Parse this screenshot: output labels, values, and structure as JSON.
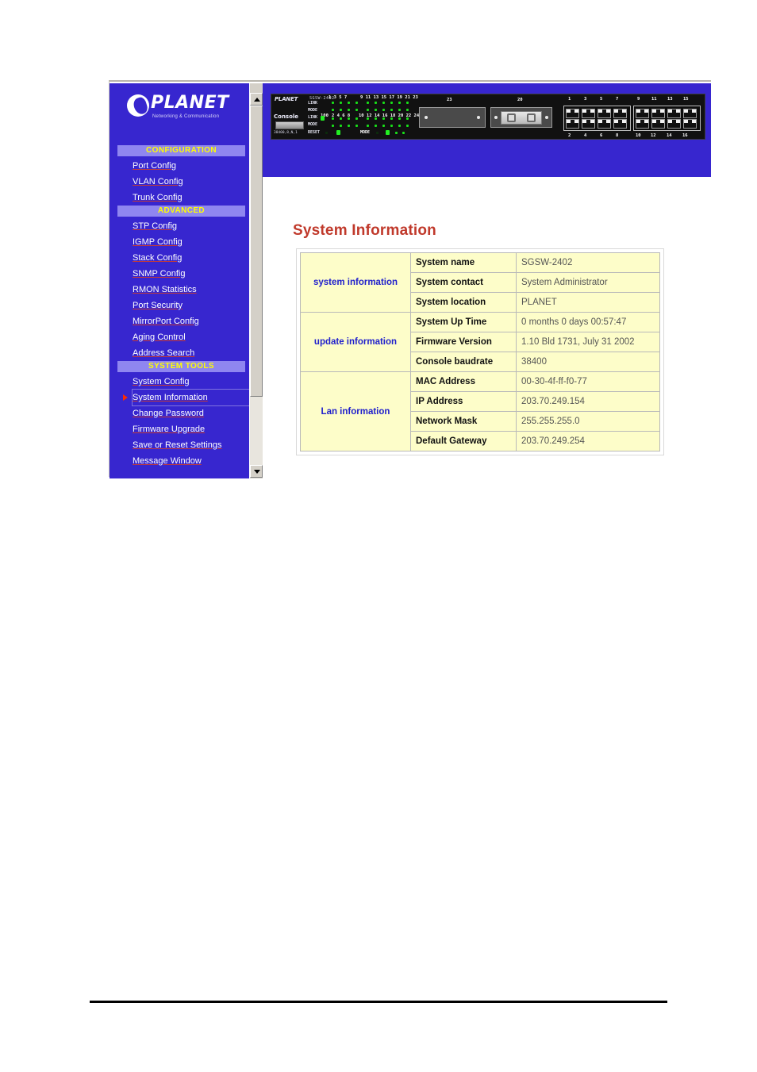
{
  "brand": {
    "name": "PLANET",
    "tagline": "Networking & Communication",
    "logo_icon": "planet-moon-logo-icon"
  },
  "sidebar": {
    "sections": [
      {
        "label": "CONFIGURATION",
        "items": [
          {
            "label": "Port Config",
            "current": false
          },
          {
            "label": "VLAN Config",
            "current": false
          },
          {
            "label": "Trunk Config",
            "current": false
          }
        ]
      },
      {
        "label": "ADVANCED",
        "items": [
          {
            "label": "STP Config",
            "current": false
          },
          {
            "label": "IGMP Config",
            "current": false
          },
          {
            "label": "Stack Config",
            "current": false
          },
          {
            "label": "SNMP Config",
            "current": false
          },
          {
            "label": "RMON Statistics",
            "current": false
          },
          {
            "label": "Port Security",
            "current": false
          },
          {
            "label": "MirrorPort Config",
            "current": false
          },
          {
            "label": "Aging Control",
            "current": false
          },
          {
            "label": "Address Search",
            "current": false
          }
        ]
      },
      {
        "label": "SYSTEM TOOLS",
        "items": [
          {
            "label": "System Config",
            "current": false
          },
          {
            "label": "System Information",
            "current": true
          },
          {
            "label": "Change Password",
            "current": false
          },
          {
            "label": "Firmware Upgrade",
            "current": false
          },
          {
            "label": "Save or Reset Settings",
            "current": false
          },
          {
            "label": "Message Window",
            "current": false
          }
        ]
      }
    ]
  },
  "device": {
    "brand": "PLANET",
    "model": "SGSW-2402",
    "port_range_top": "1 3 5 7",
    "port_range_top2": "9 11 13 15 17 19 21 23",
    "port_range_bottom": "2 4 6 8",
    "port_range_bottom2": "10 12 14 16 18 20 22 24",
    "console_label": "Console",
    "console_baud": "38400,8,N,1",
    "row_labels": [
      "LINK",
      "MODE",
      "LINK",
      "MODE",
      "RESET"
    ],
    "mode_label": "MODE",
    "speed_label": "100",
    "slot_labels": [
      "23",
      "20"
    ],
    "rj45_top_numbers": [
      [
        "1",
        "3",
        "5",
        "7"
      ],
      [
        "9",
        "11",
        "13",
        "15"
      ],
      [
        "17",
        "19",
        "21",
        "23"
      ]
    ],
    "rj45_bottom_numbers": [
      [
        "2",
        "4",
        "6",
        "8"
      ],
      [
        "10",
        "12",
        "14",
        "16"
      ],
      [
        "18",
        "20",
        "22",
        "24"
      ]
    ]
  },
  "page": {
    "title": "System Information"
  },
  "table": {
    "groups": [
      {
        "name": "system information",
        "rows": [
          {
            "label": "System name",
            "value": "SGSW-2402"
          },
          {
            "label": "System contact",
            "value": "System Administrator"
          },
          {
            "label": "System location",
            "value": "PLANET"
          }
        ]
      },
      {
        "name": "update information",
        "rows": [
          {
            "label": "System Up Time",
            "value": "0 months 0 days 00:57:47"
          },
          {
            "label": "Firmware Version",
            "value": "1.10 Bld 1731, July 31 2002"
          },
          {
            "label": "Console baudrate",
            "value": "38400"
          }
        ]
      },
      {
        "name": "Lan information",
        "rows": [
          {
            "label": "MAC Address",
            "value": "00-30-4f-ff-f0-77"
          },
          {
            "label": "IP Address",
            "value": "203.70.249.154"
          },
          {
            "label": "Network Mask",
            "value": "255.255.255.0"
          },
          {
            "label": "Default Gateway",
            "value": "203.70.249.254"
          }
        ]
      }
    ]
  },
  "scrollbar": {
    "up_icon": "scroll-up-arrow-icon",
    "down_icon": "scroll-down-arrow-icon"
  },
  "colors": {
    "nav_background": "#3726cf",
    "section_header_bg": "#8f86f0",
    "section_header_text": "#ffff00",
    "title_red": "#c0392b",
    "table_cell_bg": "#fdfdc9",
    "group_label_blue": "#2020cc",
    "current_marker": "#ff2a00"
  }
}
